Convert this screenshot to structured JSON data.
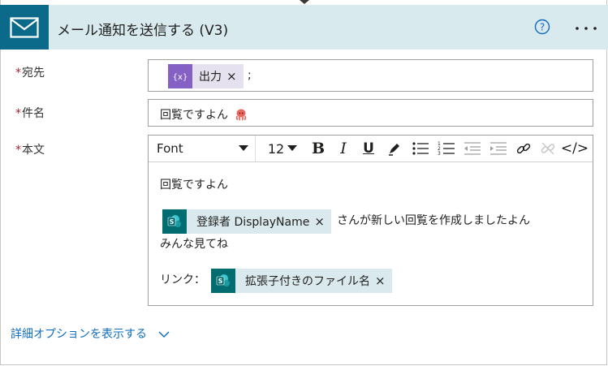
{
  "header": {
    "title": "メール通知を送信する (V3)",
    "tile_color": "#0b6a89",
    "bg_color": "#d9eaef",
    "icons": [
      "mail-icon",
      "help-icon",
      "more-options-icon"
    ]
  },
  "fields": {
    "to": {
      "label": "宛先",
      "required_mark": "*",
      "token": {
        "label": "出力",
        "icon": "variable-icon",
        "icon_color": "#8661c5",
        "remove": "×"
      },
      "separator": ";"
    },
    "subject": {
      "label": "件名",
      "required_mark": "*",
      "value": "回覧ですよん"
    },
    "body": {
      "label": "本文",
      "required_mark": "*",
      "toolbar": {
        "font": "Font",
        "size": "12",
        "bold": "B",
        "italic": "I",
        "underline": "U",
        "code_view": "</>",
        "icons": [
          "bold-icon",
          "italic-icon",
          "underline-icon",
          "highlight-pen-icon",
          "bullet-list-icon",
          "numbered-list-icon",
          "outdent-icon",
          "indent-icon",
          "link-icon",
          "unlink-icon",
          "code-view-icon"
        ]
      },
      "line1": "回覧ですよん",
      "token1": {
        "label": "登録者 DisplayName",
        "icon": "sharepoint-icon",
        "remove": "×"
      },
      "line2_after": "さんが新しい回覧を作成しましたよん",
      "line3": "みんな見てね",
      "link_label": "リンク：",
      "token2": {
        "label": "拡張子付きのファイル名",
        "icon": "sharepoint-icon",
        "remove": "×"
      }
    }
  },
  "advanced_options": "詳細オプションを表示する",
  "colors": {
    "required": "#a4262c",
    "link": "#0f6cbd",
    "token_bg": "#dae9ed",
    "sharepoint": "#036c70"
  }
}
